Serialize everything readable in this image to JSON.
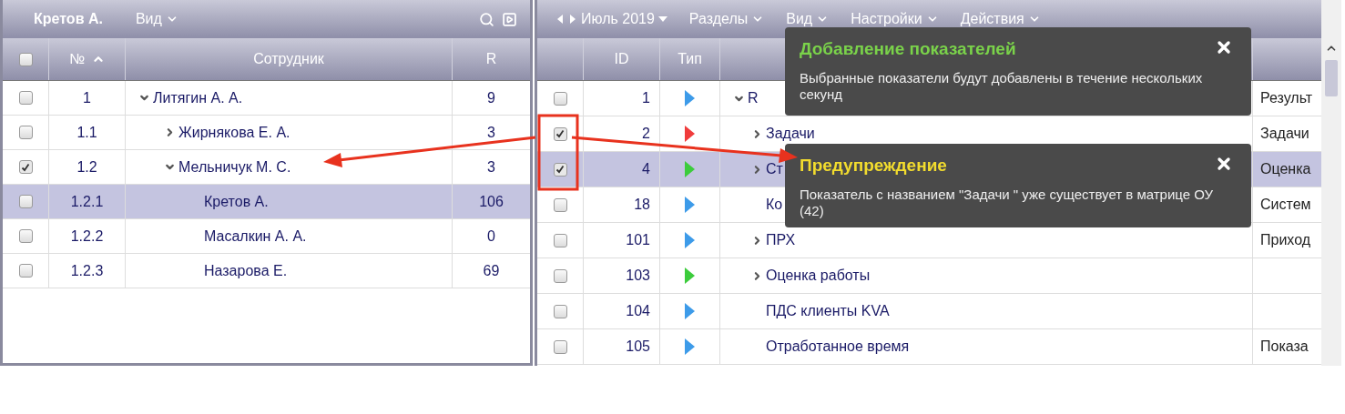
{
  "left_panel": {
    "title": "Кретов А.",
    "menu": "Вид",
    "columns": [
      "№",
      "Сотрудник",
      "R"
    ],
    "header_checked": false,
    "rows": [
      {
        "number": "1",
        "name": "Литягин А. А.",
        "r": "9",
        "checked": false,
        "selected": false,
        "expanded": true,
        "children": [
          {
            "number": "1.1",
            "name": "Жирнякова Е. А.",
            "r": "3",
            "checked": false,
            "selected": false,
            "expanded": false
          },
          {
            "number": "1.2",
            "name": "Мельничук М. С.",
            "r": "3",
            "checked": true,
            "selected": false,
            "expanded": true,
            "children": [
              {
                "number": "1.2.1",
                "name": "Кретов А.",
                "r": "106",
                "checked": false,
                "selected": true
              },
              {
                "number": "1.2.2",
                "name": "Масалкин А. А.",
                "r": "0",
                "checked": false,
                "selected": false
              },
              {
                "number": "1.2.3",
                "name": "Назарова Е.",
                "r": "69",
                "checked": false,
                "selected": false
              }
            ]
          }
        ]
      }
    ]
  },
  "right_panel": {
    "period": "Июль 2019",
    "menus": [
      "Разделы",
      "Вид",
      "Настройки",
      "Действия"
    ],
    "columns": [
      "ID",
      "Тип"
    ],
    "rows": [
      {
        "id": "1",
        "color": "#3d9be9",
        "name": "R",
        "column_4": "Результ",
        "checked": false,
        "selected": false,
        "expanded": true,
        "children": [
          {
            "id": "2",
            "color": "#f03c3c",
            "name": "Задачи",
            "column_4": "Задачи",
            "checked": true,
            "selected": false,
            "expanded": false
          },
          {
            "id": "4",
            "color": "#3ccc3c",
            "name": "Ст",
            "column_4": "Оценка",
            "checked": true,
            "selected": true,
            "expanded": false
          },
          {
            "id": "18",
            "color": "#3d9be9",
            "name": "Ко",
            "column_4": "Систем",
            "checked": false,
            "selected": false
          },
          {
            "id": "101",
            "color": "#3d9be9",
            "name": "ПРХ",
            "column_4": "Приход",
            "checked": false,
            "selected": false,
            "expanded": false
          },
          {
            "id": "103",
            "color": "#3ccc3c",
            "name": "Оценка работы",
            "checked": false,
            "selected": false,
            "expanded": false
          },
          {
            "id": "104",
            "color": "#3d9be9",
            "name": "ПДС клиенты KVA",
            "checked": false,
            "selected": false
          },
          {
            "id": "105",
            "color": "#3d9be9",
            "name": "Отработанное время",
            "column_4": "Показа",
            "checked": false,
            "selected": false
          }
        ]
      }
    ]
  },
  "notifications": [
    {
      "kind": "success",
      "title": "Добавление показателей",
      "message": "Выбранные показатели будут добавлены в течение нескольких секунд"
    },
    {
      "kind": "warning",
      "title": "Предупреждение",
      "message": "Показатель с названием \"Задачи \" уже существует в матрице ОУ (42)"
    }
  ]
}
